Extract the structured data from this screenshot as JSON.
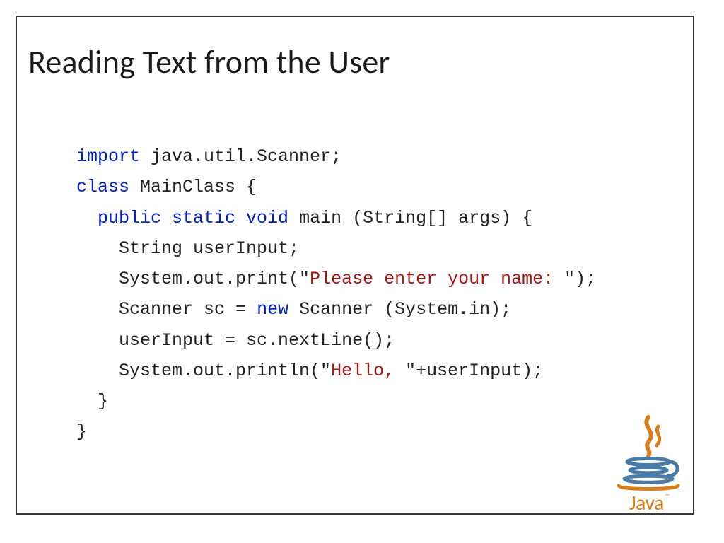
{
  "slide": {
    "title": "Reading Text from the User",
    "code": {
      "line1": {
        "kw": "import",
        "rest": " java.util.Scanner;"
      },
      "line2": {
        "kw": "class",
        "rest": " MainClass {"
      },
      "line3": {
        "indent": "  ",
        "kw": "public static void",
        "rest": " main (String[] args) {"
      },
      "line4": {
        "indent": "    ",
        "text": "String userInput;"
      },
      "line5": {
        "indent": "    ",
        "pre": "System.out.print(\"",
        "str": "Please enter your name: ",
        "post": "\");"
      },
      "line6": {
        "indent": "    ",
        "pre": "Scanner sc = ",
        "kw": "new",
        "post": " Scanner (System.in);"
      },
      "line7": {
        "indent": "    ",
        "text": "userInput = sc.nextLine();"
      },
      "line8": {
        "indent": "    ",
        "pre": "System.out.println(\"",
        "str": "Hello, ",
        "post": "\"+userInput);"
      },
      "line9": {
        "indent": "  ",
        "text": "}"
      },
      "line10": {
        "text": "}"
      }
    },
    "logo": {
      "word": "Java",
      "tm": "™"
    }
  },
  "colors": {
    "outer_border": "#3a3a3a",
    "inner_border": "#e6a73c",
    "keyword": "#0020c2",
    "string": "#a31515",
    "logo_orange": "#d97c1a",
    "logo_blue": "#4a7ba6"
  }
}
